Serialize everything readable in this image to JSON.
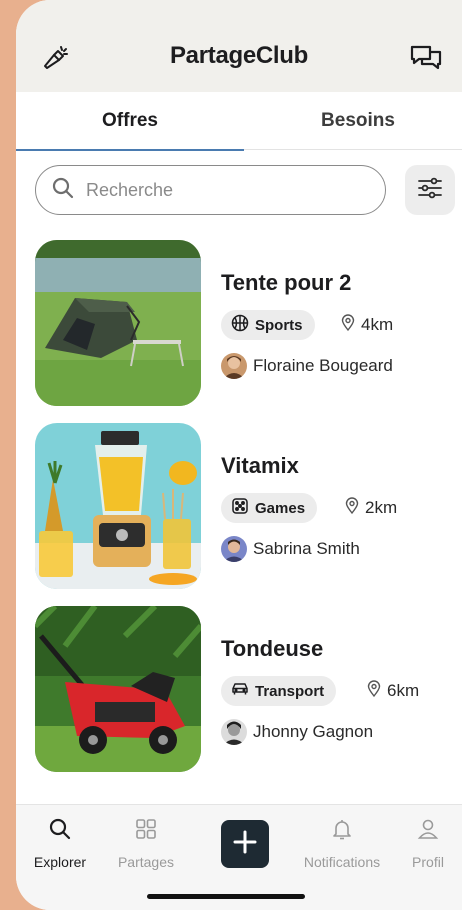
{
  "header": {
    "title": "PartageClub",
    "left_icon": "flashlight-icon",
    "right_icon": "chat-bubbles-icon"
  },
  "tabs": [
    {
      "label": "Offres",
      "active": true
    },
    {
      "label": "Besoins",
      "active": false
    }
  ],
  "search": {
    "placeholder": "Recherche",
    "value": ""
  },
  "items": [
    {
      "title": "Tente pour 2",
      "category": "Sports",
      "category_icon": "basketball-icon",
      "distance": "4km",
      "owner": "Floraine Bougeard"
    },
    {
      "title": "Vitamix",
      "category": "Games",
      "category_icon": "dice-icon",
      "distance": "2km",
      "owner": "Sabrina Smith"
    },
    {
      "title": "Tondeuse",
      "category": "Transport",
      "category_icon": "car-icon",
      "distance": "6km",
      "owner": "Jhonny Gagnon"
    }
  ],
  "nav": [
    {
      "label": "Explorer",
      "icon": "search-icon",
      "active": true
    },
    {
      "label": "Partages",
      "icon": "grid-icon",
      "active": false
    },
    {
      "label": "",
      "icon": "plus-icon",
      "active": false
    },
    {
      "label": "Notifications",
      "icon": "bell-icon",
      "active": false
    },
    {
      "label": "Profil",
      "icon": "user-icon",
      "active": false
    }
  ],
  "colors": {
    "background": "#e8b08e",
    "header": "#f1f0ec",
    "tab_underline": "#4a7bb0",
    "plus_button": "#1e2a33"
  }
}
